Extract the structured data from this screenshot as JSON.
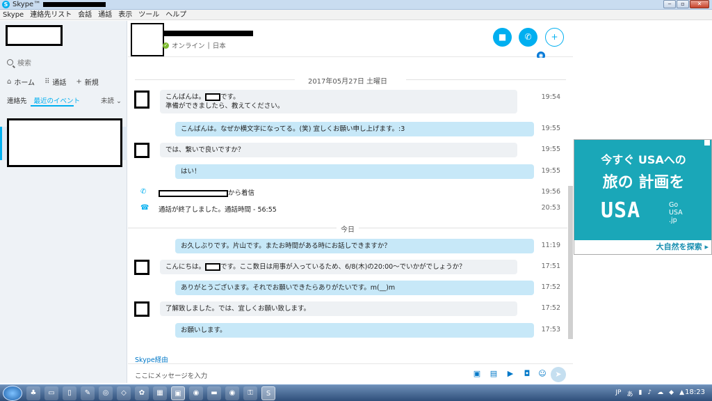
{
  "window": {
    "title": "Skype™",
    "menu": [
      "Skype",
      "連絡先リスト",
      "会話",
      "通話",
      "表示",
      "ツール",
      "ヘルプ"
    ]
  },
  "sidebar": {
    "search_placeholder": "検索",
    "nav": [
      {
        "icon": "home-icon",
        "label": "ホーム"
      },
      {
        "icon": "dialpad-icon",
        "label": "通話"
      },
      {
        "icon": "plus-icon",
        "label": "新規"
      }
    ],
    "tabs": [
      "連絡先",
      "最近のイベント"
    ],
    "active_tab": "最近のイベント",
    "filter_label": "未読"
  },
  "chat_header": {
    "status": "オンライン",
    "location": "日本"
  },
  "dates": {
    "first": "2017年05月27日 土曜日",
    "second": "今日"
  },
  "messages": [
    {
      "dir": "in",
      "lines": [
        "こんばんは。",
        "です。",
        "準備ができましたら、教えてください。"
      ],
      "time": "19:54"
    },
    {
      "dir": "out",
      "text": "こんばんは。なぜか横文字になってる。(笑) 宜しくお願い申し上げます。:3",
      "time": "19:55"
    },
    {
      "dir": "in",
      "text": "では、繋いで良いですか？",
      "time": "19:55"
    },
    {
      "dir": "out",
      "text": "はい！",
      "time": "19:55"
    },
    {
      "dir": "call_in",
      "text": "から着信",
      "time": "19:56"
    },
    {
      "dir": "call_end",
      "text": "通話が終了しました。通話時間 - 56:55",
      "time": "20:53"
    },
    {
      "dir": "out",
      "text": "お久しぶりです。片山です。またお時間がある時にお話しできますか？",
      "time": "11:19"
    },
    {
      "dir": "in",
      "text_pre": "こんにちは。",
      "text_post": "です。ここ数日は用事が入っているため、6/8(木)の20:00～でいかがでしょうか？",
      "time": "17:51"
    },
    {
      "dir": "out",
      "text": "ありがとうございます。それでお願いできたらありがたいです。m(__)m",
      "time": "17:52"
    },
    {
      "dir": "in",
      "text": "了解致しました。では、宜しくお願い致します。",
      "time": "17:52"
    },
    {
      "dir": "out",
      "text": "お願いします。",
      "time": "17:53"
    }
  ],
  "composer": {
    "typing_label": "Skype経由",
    "placeholder": "ここにメッセージを入力"
  },
  "ad": {
    "line1": "今すぐ USAへの",
    "line2": "旅の 計画を",
    "logo": "USA",
    "logo_side": [
      "Go",
      "USA",
      ".jp"
    ],
    "cta": "大自然を探索 ▸"
  },
  "taskbar": {
    "lang": "JP",
    "time": "18:23"
  },
  "colors": {
    "accent": "#00aff0",
    "bubble_out": "#c7e8f8",
    "bubble_in": "#eef1f4",
    "ad_bg": "#1aa7b8"
  }
}
